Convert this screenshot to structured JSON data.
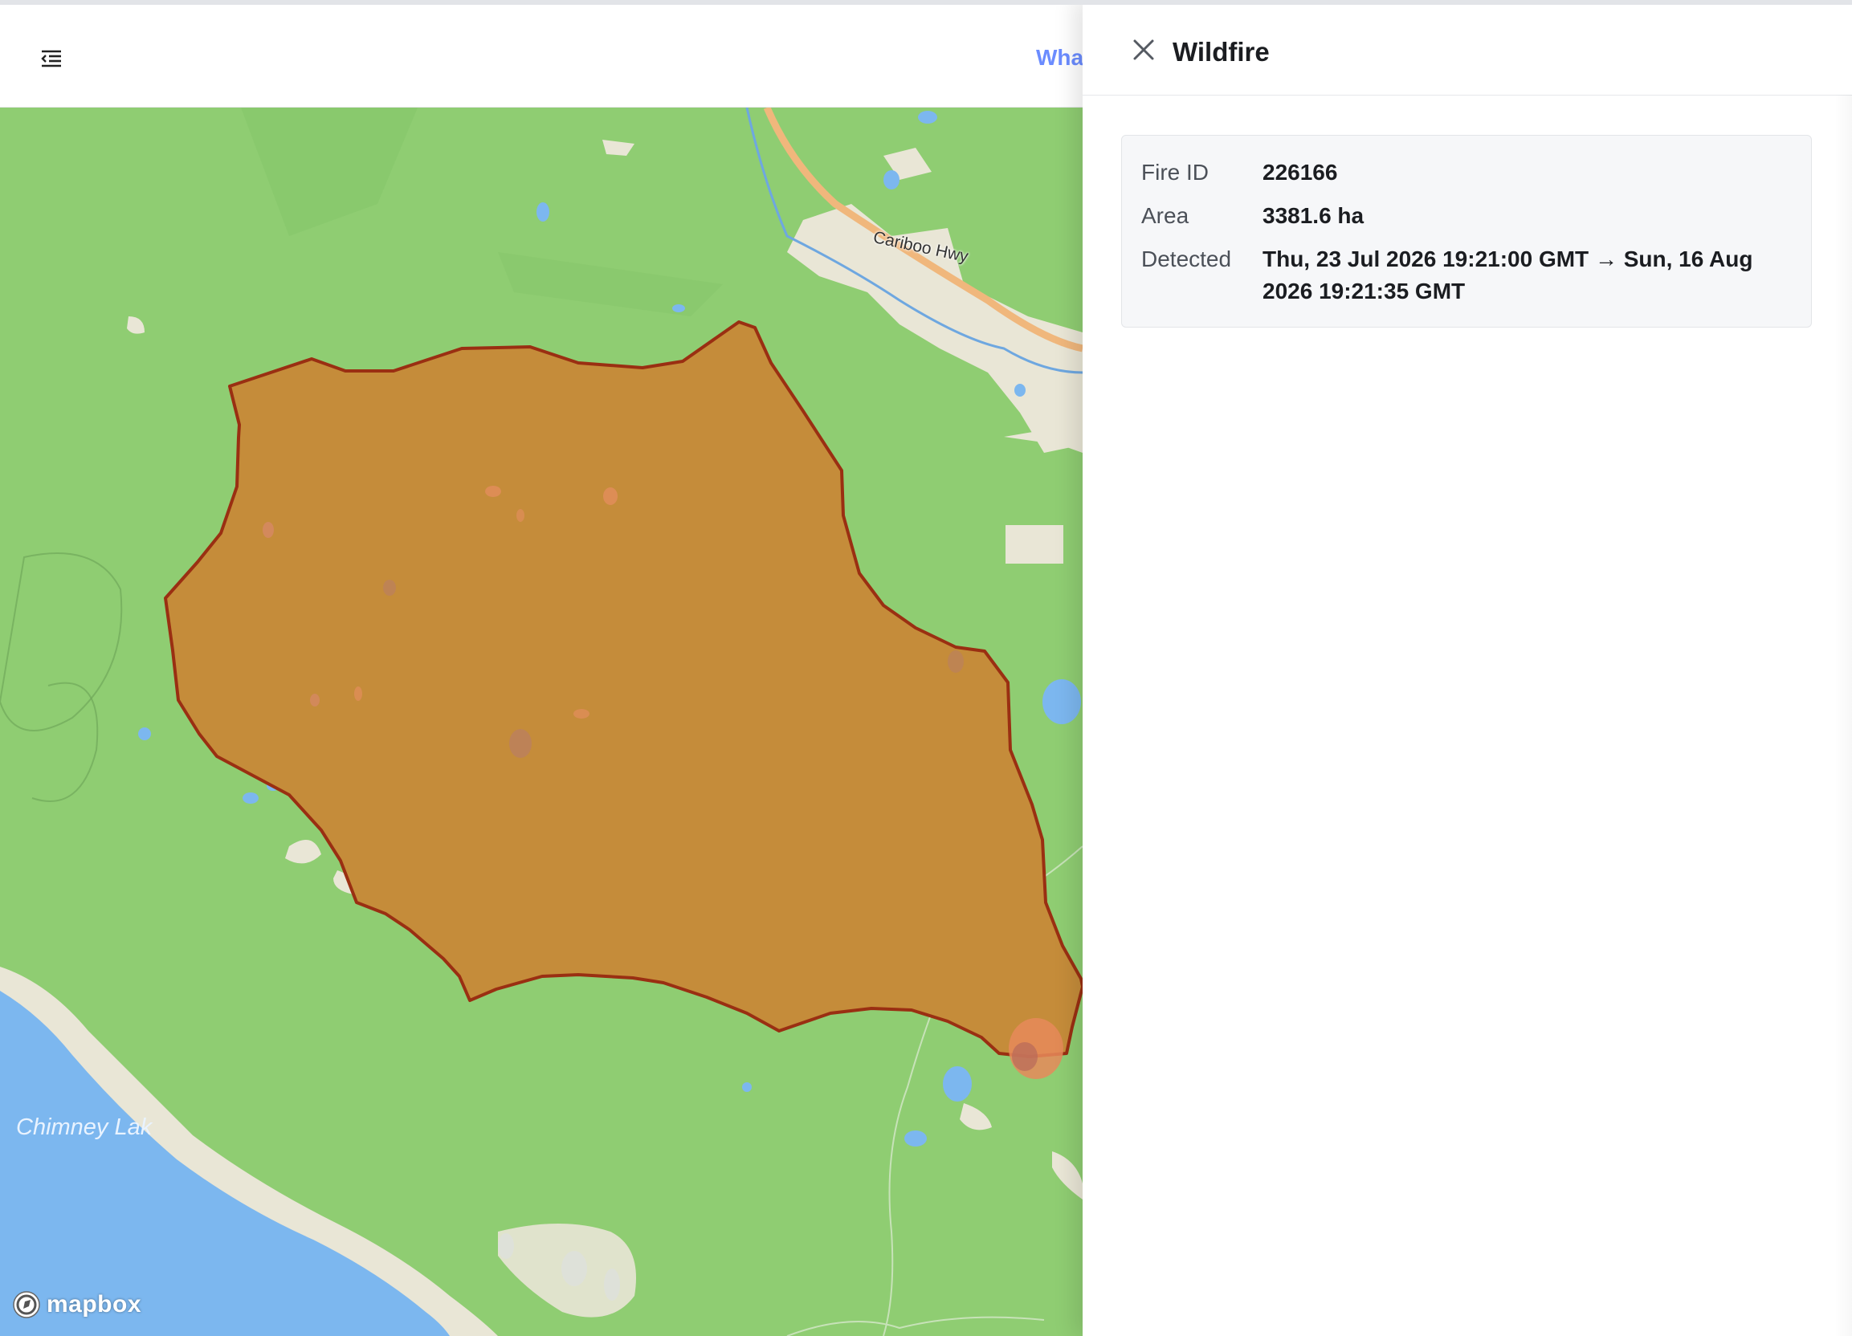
{
  "header": {
    "menu_icon": "menu-collapse-icon",
    "link_label": "Wha"
  },
  "map": {
    "road_label": "Cariboo Hwy",
    "lake_label": "Chimney Lak",
    "attribution": "mapbox",
    "colors": {
      "land": "#8fcd72",
      "water": "#7cb7ef",
      "fire_fill": "#c58c3a",
      "fire_outline": "#9a2f12",
      "highway": "#f0b77c",
      "developed": "#e9e6d6"
    }
  },
  "panel": {
    "title": "Wildfire",
    "close_icon": "close-icon",
    "details": [
      {
        "label": "Fire ID",
        "value": "226166"
      },
      {
        "label": "Area",
        "value": "3381.6 ha"
      },
      {
        "label": "Detected",
        "value": "Thu, 23 Jul 2026 19:21:00 GMT → Sun, 16 Aug 2026 19:21:35 GMT"
      }
    ]
  }
}
